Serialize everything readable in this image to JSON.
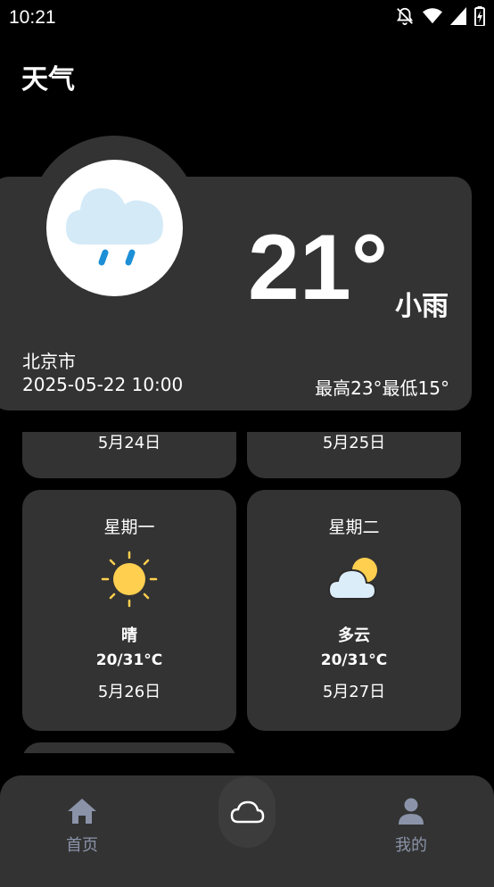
{
  "status": {
    "time": "10:21"
  },
  "app": {
    "title": "天气"
  },
  "current": {
    "temp": "21°",
    "condition": "小雨",
    "city": "北京市",
    "datetime": "2025-05-22 10:00",
    "range": "最高23°最低15°",
    "icon": "light-rain-icon"
  },
  "forecast": [
    {
      "date": "5月24日"
    },
    {
      "date": "5月25日"
    },
    {
      "weekday": "星期一",
      "condition": "晴",
      "temp": "20/31°C",
      "date": "5月26日",
      "icon": "sunny-icon"
    },
    {
      "weekday": "星期二",
      "condition": "多云",
      "temp": "20/31°C",
      "date": "5月27日",
      "icon": "partly-cloudy-icon"
    }
  ],
  "nav": {
    "home_label": "首页",
    "home_icon": "home-icon",
    "weather_icon": "cloud-icon",
    "mine_label": "我的",
    "mine_icon": "person-icon"
  },
  "colors": {
    "background": "#000000",
    "card": "#333333",
    "nav_inactive": "#8a93a8",
    "sun": "#ffcf4f",
    "rain": "#1c8fd6"
  }
}
